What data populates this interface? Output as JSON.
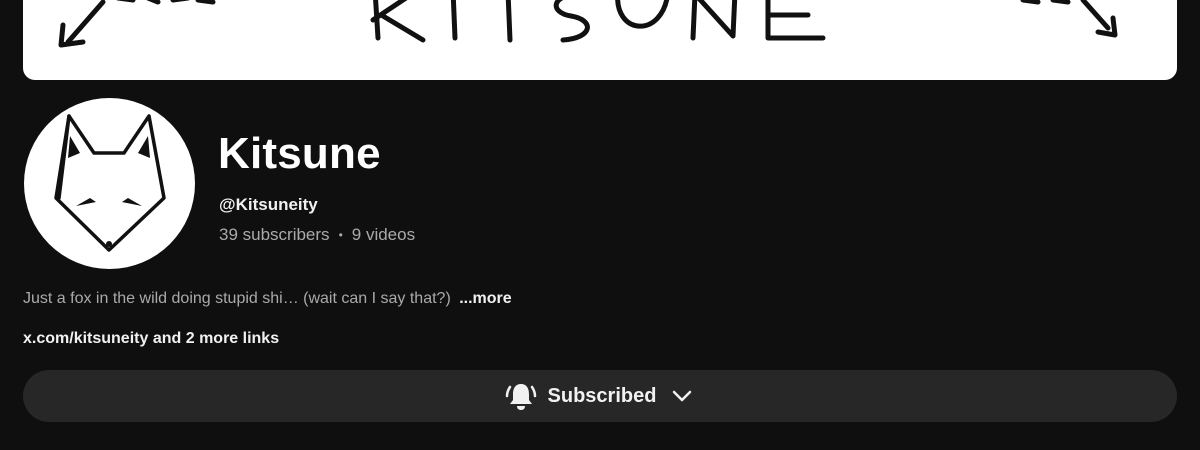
{
  "banner": {
    "text": "KITSUNE"
  },
  "channel": {
    "name": "Kitsune",
    "handle": "@Kitsuneity",
    "subscribers": "39 subscribers",
    "separator": "•",
    "videos": "9 videos"
  },
  "description": {
    "text": "Just a fox in the wild doing stupid shi… (wait can I say that?)",
    "more_label": "...more"
  },
  "links": {
    "primary": "x.com/kitsuneity",
    "more": "and 2 more links"
  },
  "subscribe_button": {
    "label": "Subscribed",
    "bell_icon": "bell-ringing-icon",
    "chevron_icon": "chevron-down-icon"
  },
  "colors": {
    "background": "#0f0f0f",
    "button": "#272727",
    "secondary_text": "#aaaaaa"
  }
}
